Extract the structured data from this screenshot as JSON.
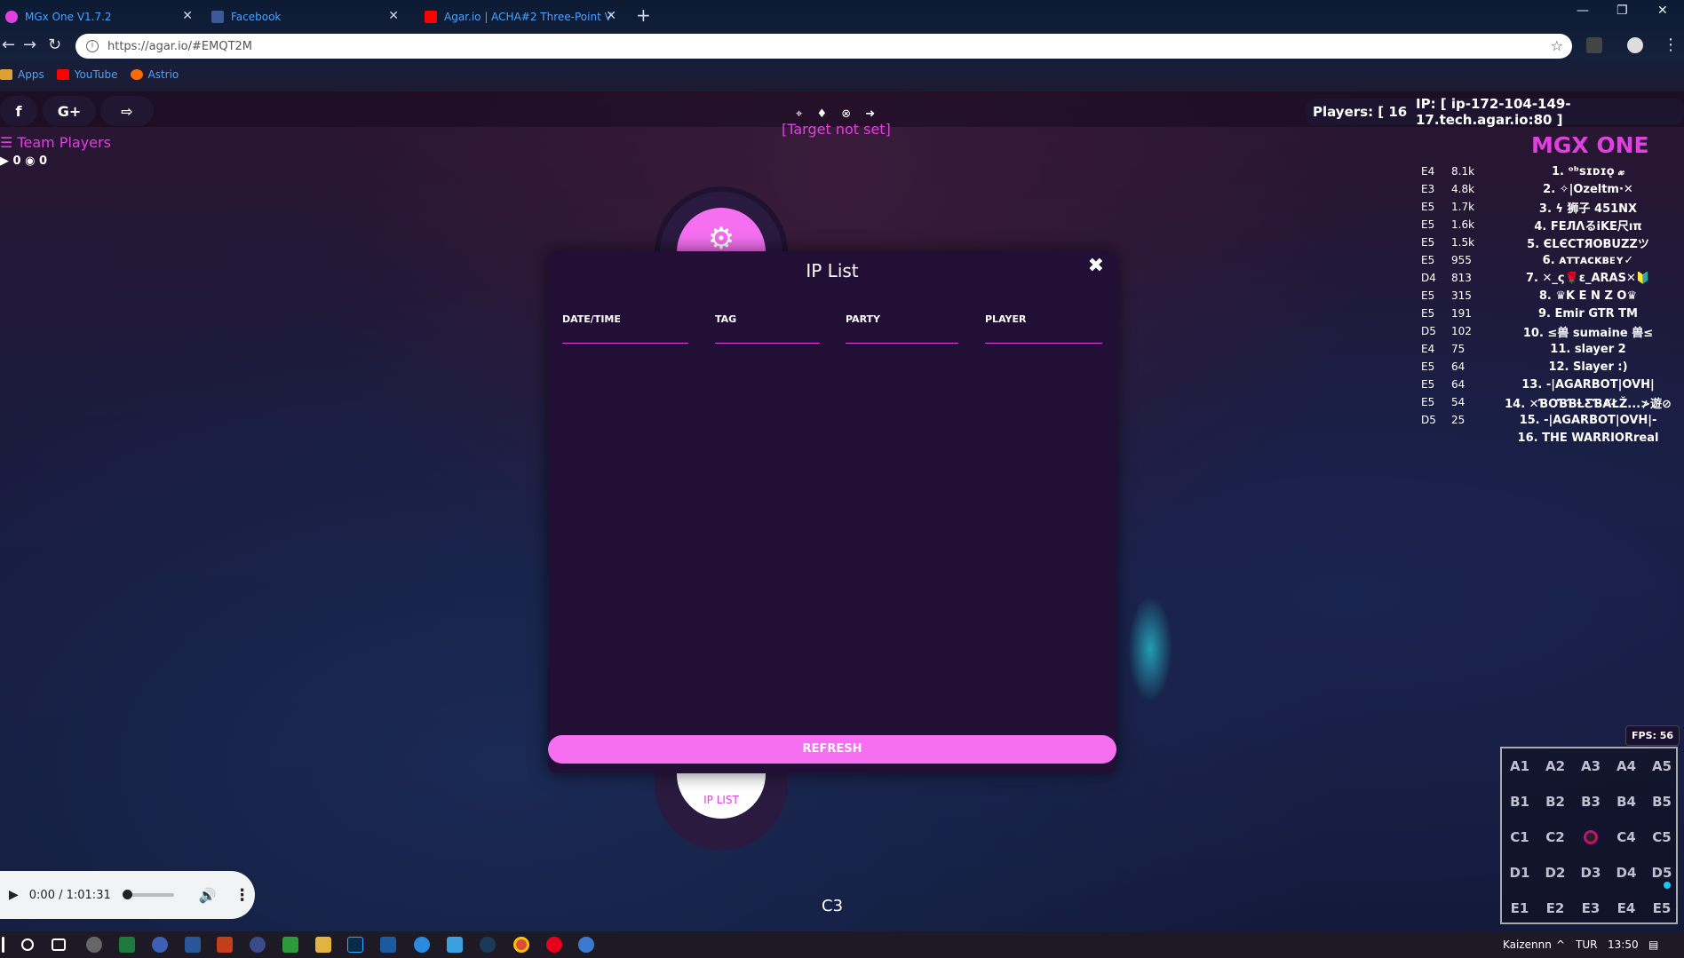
{
  "browser": {
    "tabs": [
      {
        "title": "MGx One V1.7.2",
        "icon": "mgx-icon",
        "color": "#e040e0"
      },
      {
        "title": "Facebook",
        "icon": "facebook-icon",
        "color": "#3b5998"
      },
      {
        "title": "Agar.io | ACHA#2 Three-Point V",
        "icon": "youtube-icon",
        "color": "#ff0000"
      }
    ],
    "url": "https://agar.io/#EMQT2M",
    "bookmarks": [
      {
        "label": "Apps",
        "icon": "apps-icon",
        "color": "#e0a030"
      },
      {
        "label": "YouTube",
        "icon": "youtube-icon",
        "color": "#ff0000"
      },
      {
        "label": "Astrio",
        "icon": "astrio-icon",
        "color": "#ff6a00"
      }
    ]
  },
  "game": {
    "social_buttons": [
      {
        "label": "f",
        "icon": "facebook-icon"
      },
      {
        "label": "G+",
        "icon": "google-plus-icon"
      },
      {
        "label": "⇨",
        "icon": "logout-icon"
      }
    ],
    "players_label": "Players: [ 16 ]",
    "server_ip": "IP: [ ip-172-104-149-17.tech.agar.io:80 ]",
    "team_players": "☰ Team Players",
    "team_counts": "▶ 0 ◉ 0",
    "target_icons": "⌖ ♦ ⊗ ➜",
    "target_status": "[Target not set]",
    "leaderboard_title": "MGX ONE",
    "leaderboard": [
      {
        "cell": "E4",
        "mass": "8.1k",
        "name": "1. ᵒᵇsɪᴅɪǫ       𝔁"
      },
      {
        "cell": "E3",
        "mass": "4.8k",
        "name": "2. ✧|Özeltm·✕"
      },
      {
        "cell": "E5",
        "mass": "1.7k",
        "name": "3. ϟ     狮子 451NX"
      },
      {
        "cell": "E5",
        "mass": "1.6k",
        "name": "4. FEЛΛるiKE尺ıπ"
      },
      {
        "cell": "E5",
        "mass": "1.5k",
        "name": "5. ЄLЄCTЯOBUZZツ"
      },
      {
        "cell": "E5",
        "mass": "955",
        "name": "6. ᴀᴛᴛᴀᴄᴋʙᴇʏ✓"
      },
      {
        "cell": "D4",
        "mass": "813",
        "name": "7. ✕_ς🌹ε_ARAŠ✕🔰"
      },
      {
        "cell": "E5",
        "mass": "315",
        "name": "8. ♛K E N Z O♛"
      },
      {
        "cell": "E5",
        "mass": "191",
        "name": "9. Emir GTR TM"
      },
      {
        "cell": "D5",
        "mass": "102",
        "name": "10. ≤兽 sumaine 兽≤"
      },
      {
        "cell": "E4",
        "mass": "75",
        "name": "11. slayer 2"
      },
      {
        "cell": "E5",
        "mass": "64",
        "name": "12. Slayer :)"
      },
      {
        "cell": "E5",
        "mass": "64",
        "name": "13. -|AGARBOT|OVH|"
      },
      {
        "cell": "E5",
        "mass": "54",
        "name": "14. ✕ƁƠƁƁȽƸƁȺŁŽ...≯遊⊘"
      },
      {
        "cell": "D5",
        "mass": "25",
        "name": "15. -|AGARBOT|OVH|-"
      },
      {
        "cell": "",
        "mass": "",
        "name": "16. THE WARRIORreal"
      }
    ],
    "menu_iplist_label": "IP LIST",
    "modal": {
      "title": "IP List",
      "close": "✖",
      "columns": [
        "DATE/TIME",
        "TAG",
        "PARTY",
        "PLAYER"
      ],
      "refresh_label": "REFRESH"
    },
    "audio": {
      "time": "0:00 / 1:01:31"
    },
    "current_cell": "C3",
    "fps": "FPS: 56",
    "minimap": [
      "A1",
      "A2",
      "A3",
      "A4",
      "A5",
      "B1",
      "B2",
      "B3",
      "B4",
      "B5",
      "C1",
      "C2",
      "C3",
      "C4",
      "C5",
      "D1",
      "D2",
      "D3",
      "D4",
      "D5",
      "E1",
      "E2",
      "E3",
      "E4",
      "E5"
    ]
  },
  "taskbar": {
    "user": "Kaizennn",
    "lang": "TUR",
    "time": "13:50"
  }
}
